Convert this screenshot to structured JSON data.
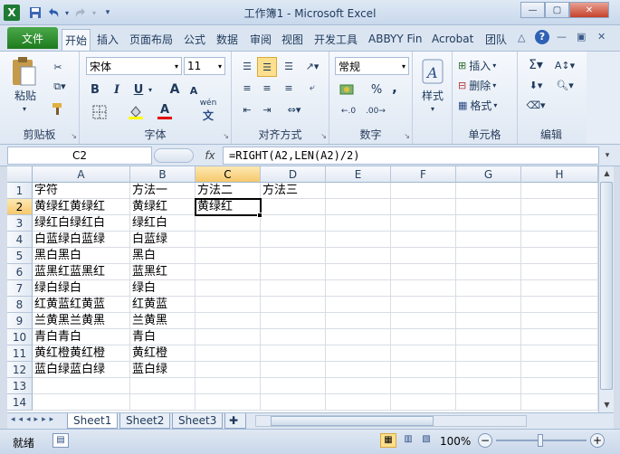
{
  "window": {
    "title": "工作簿1 - Microsoft Excel"
  },
  "qat": {
    "save_icon": "save-icon",
    "undo_icon": "undo-icon",
    "redo_icon": "redo-icon"
  },
  "tabs": [
    "开始",
    "插入",
    "页面布局",
    "公式",
    "数据",
    "审阅",
    "视图",
    "开发工具",
    "ABBYY Fin",
    "Acrobat",
    "团队"
  ],
  "file_tab": "文件",
  "ribbon": {
    "clipboard": {
      "label": "剪贴板",
      "paste": "粘贴"
    },
    "font": {
      "label": "字体",
      "name": "宋体",
      "size": "11",
      "bold": "B",
      "italic": "I",
      "underline": "U",
      "grow": "A",
      "shrink": "A",
      "wen": "wén",
      "color_letter": "A"
    },
    "align": {
      "label": "对齐方式"
    },
    "number": {
      "label": "数字",
      "format": "常规",
      "percent": "%",
      "comma": ","
    },
    "style": {
      "label": "样式"
    },
    "cells": {
      "label": "单元格",
      "insert": "插入",
      "delete": "删除",
      "format": "格式"
    },
    "edit": {
      "label": "编辑"
    }
  },
  "formula_bar": {
    "name_box": "C2",
    "fx": "fx",
    "formula": "=RIGHT(A2,LEN(A2)/2)"
  },
  "columns": [
    "A",
    "B",
    "C",
    "D",
    "E",
    "F",
    "G",
    "H"
  ],
  "rows": [
    "1",
    "2",
    "3",
    "4",
    "5",
    "6",
    "7",
    "8",
    "9",
    "10",
    "11",
    "12",
    "13",
    "14"
  ],
  "cells": {
    "A": [
      "字符",
      "黄绿红黄绿红",
      "绿红白绿红白",
      "白蓝绿白蓝绿",
      "黑白黑白",
      "蓝黑红蓝黑红",
      "绿白绿白",
      "红黄蓝红黄蓝",
      "兰黄黑兰黄黑",
      "青白青白",
      "黄红橙黄红橙",
      "蓝白绿蓝白绿",
      "",
      ""
    ],
    "B": [
      "方法一",
      "黄绿红",
      "绿红白",
      "白蓝绿",
      "黑白",
      "蓝黑红",
      "绿白",
      "红黄蓝",
      "兰黄黑",
      "青白",
      "黄红橙",
      "蓝白绿",
      "",
      ""
    ],
    "C": [
      "方法二",
      "黄绿红",
      "",
      "",
      "",
      "",
      "",
      "",
      "",
      "",
      "",
      "",
      "",
      ""
    ],
    "D": [
      "方法三",
      "",
      "",
      "",
      "",
      "",
      "",
      "",
      "",
      "",
      "",
      "",
      "",
      ""
    ]
  },
  "sheets": [
    "Sheet1",
    "Sheet2",
    "Sheet3"
  ],
  "status": {
    "ready": "就绪",
    "zoom": "100%"
  }
}
